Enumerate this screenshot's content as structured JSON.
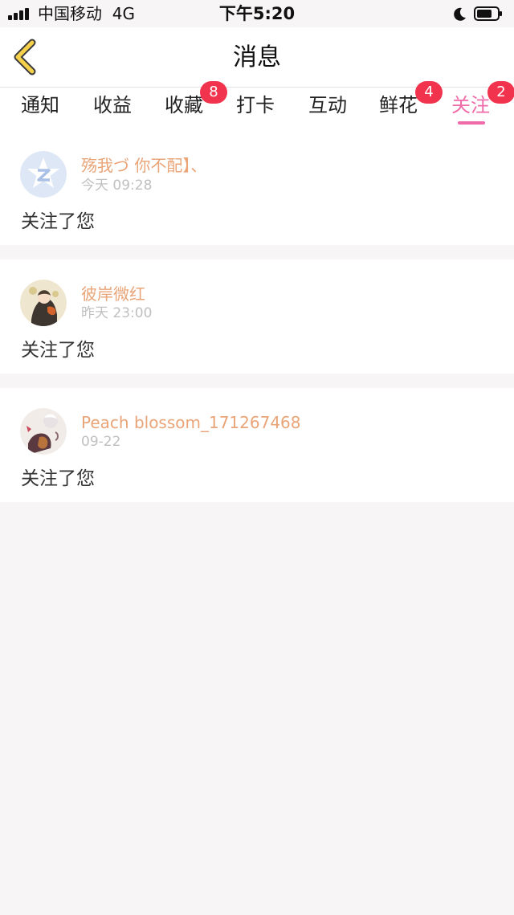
{
  "status_bar": {
    "carrier": "中国移动",
    "network": "4G",
    "time": "下午5:20"
  },
  "nav": {
    "title": "消息"
  },
  "tabs": [
    {
      "label": "通知",
      "badge": ""
    },
    {
      "label": "收益",
      "badge": ""
    },
    {
      "label": "收藏",
      "badge": "8"
    },
    {
      "label": "打卡",
      "badge": ""
    },
    {
      "label": "互动",
      "badge": ""
    },
    {
      "label": "鲜花",
      "badge": "4"
    },
    {
      "label": "关注",
      "badge": "2",
      "active": true
    }
  ],
  "notifications": [
    {
      "user": "殇我づ 你不配】、",
      "time": "今天 09:28",
      "message": "关注了您",
      "avatar": "default-avatar-icon"
    },
    {
      "user": "彼岸微红",
      "time": "昨天 23:00",
      "message": "关注了您",
      "avatar": "anime-avatar"
    },
    {
      "user": "Peach blossom_171267468",
      "time": "09-22",
      "message": "关注了您",
      "avatar": "anime-avatar"
    }
  ],
  "colors": {
    "accent": "#ef6aa8",
    "badge": "#f2334e",
    "username": "#e9a478",
    "back_arrow": "#f5d04a"
  }
}
